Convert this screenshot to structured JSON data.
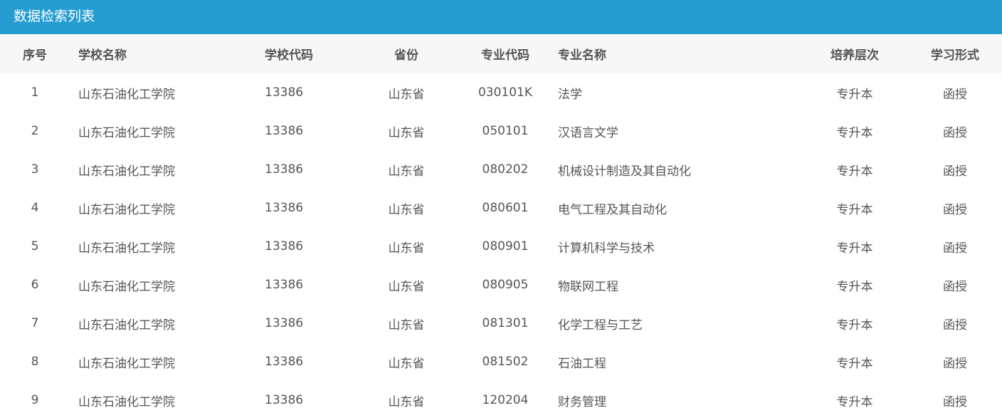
{
  "panel": {
    "title": "数据检索列表"
  },
  "table": {
    "headers": [
      "序号",
      "学校名称",
      "学校代码",
      "省份",
      "专业代码",
      "专业名称",
      "培养层次",
      "学习形式"
    ],
    "rows": [
      [
        "1",
        "山东石油化工学院",
        "13386",
        "山东省",
        "030101K",
        "法学",
        "专升本",
        "函授"
      ],
      [
        "2",
        "山东石油化工学院",
        "13386",
        "山东省",
        "050101",
        "汉语言文学",
        "专升本",
        "函授"
      ],
      [
        "3",
        "山东石油化工学院",
        "13386",
        "山东省",
        "080202",
        "机械设计制造及其自动化",
        "专升本",
        "函授"
      ],
      [
        "4",
        "山东石油化工学院",
        "13386",
        "山东省",
        "080601",
        "电气工程及其自动化",
        "专升本",
        "函授"
      ],
      [
        "5",
        "山东石油化工学院",
        "13386",
        "山东省",
        "080901",
        "计算机科学与技术",
        "专升本",
        "函授"
      ],
      [
        "6",
        "山东石油化工学院",
        "13386",
        "山东省",
        "080905",
        "物联网工程",
        "专升本",
        "函授"
      ],
      [
        "7",
        "山东石油化工学院",
        "13386",
        "山东省",
        "081301",
        "化学工程与工艺",
        "专升本",
        "函授"
      ],
      [
        "8",
        "山东石油化工学院",
        "13386",
        "山东省",
        "081502",
        "石油工程",
        "专升本",
        "函授"
      ],
      [
        "9",
        "山东石油化工学院",
        "13386",
        "山东省",
        "120204",
        "财务管理",
        "专升本",
        "函授"
      ]
    ]
  }
}
